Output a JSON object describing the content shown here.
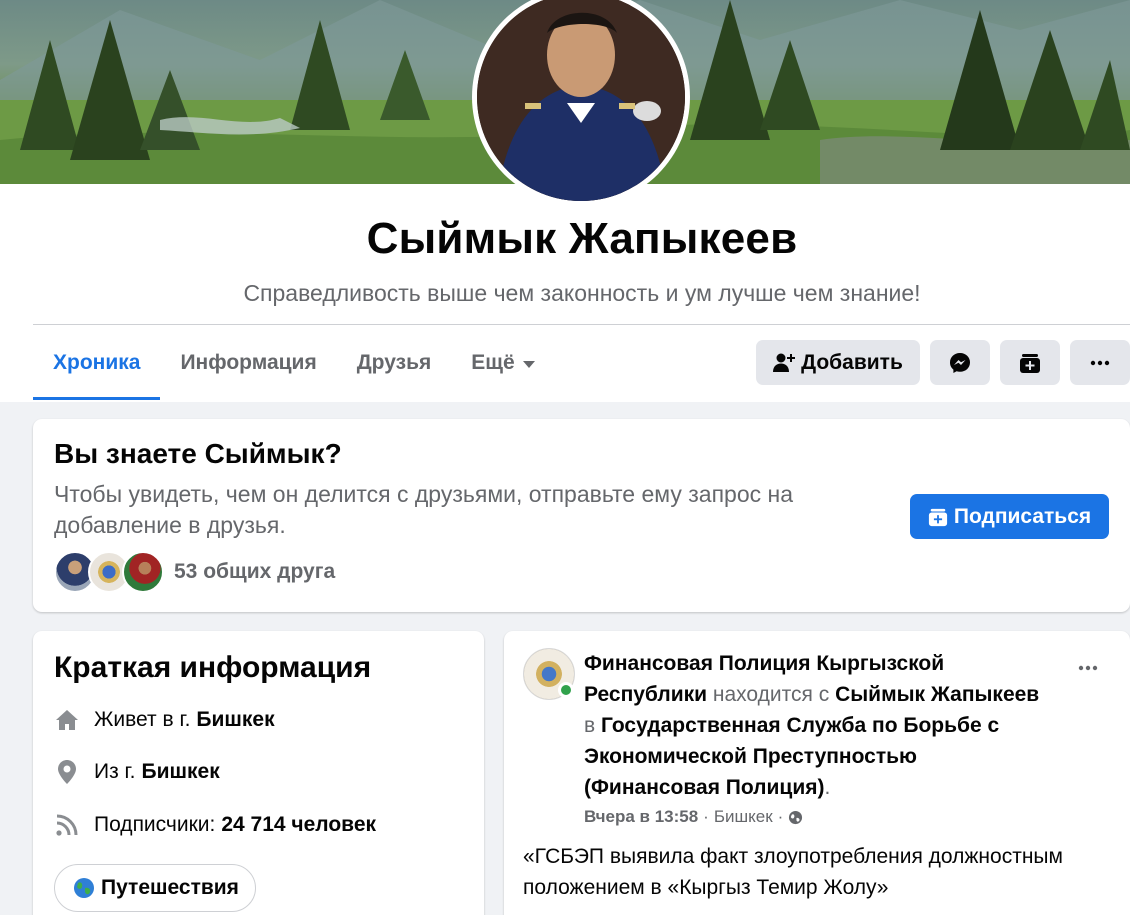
{
  "profile": {
    "name": "Сыймык Жапыкеев",
    "bio": "Справедливость выше чем законность и ум лучше чем знание!"
  },
  "tabs": [
    {
      "label": "Хроника",
      "active": true
    },
    {
      "label": "Информация",
      "active": false
    },
    {
      "label": "Друзья",
      "active": false
    },
    {
      "label": "Ещё",
      "active": false
    }
  ],
  "actions": {
    "add_friend_label": "Добавить",
    "messenger_icon": "messenger-icon",
    "follow_icon": "follow-icon",
    "more_icon": "more-dots-icon"
  },
  "know_card": {
    "title": "Вы знаете Сыймык?",
    "text": "Чтобы увидеть, чем он делится с друзьями, отправьте ему запрос на добавление в друзья.",
    "subscribe_label": "Подписаться",
    "mutual_friends": "53 общих друга"
  },
  "intro": {
    "title": "Краткая информация",
    "lives_prefix": "Живет в г.",
    "lives_city": "Бишкек",
    "from_prefix": "Из г.",
    "from_city": "Бишкек",
    "followers_prefix": "Подписчики:",
    "followers_value": "24 714 человек",
    "hobby": "Путешествия"
  },
  "post": {
    "page": "Финансовая Полиция Кыргызской Республики",
    "is_with": "находится с",
    "person": "Сыймык Жапыкеев",
    "in": "в",
    "place": "Государственная Служба по Борьбе с Экономической Преступностью (Финансовая Полиция)",
    "dot": ".",
    "time": "Вчера в 13:58",
    "location": "Бишкек",
    "body": "«ГСБЭП выявила факт злоупотребления должностным положением в «Кыргыз Темир Жолу»"
  },
  "colors": {
    "accent": "#1b74e4",
    "secondary_text": "#65676b",
    "online": "#31a24c"
  }
}
